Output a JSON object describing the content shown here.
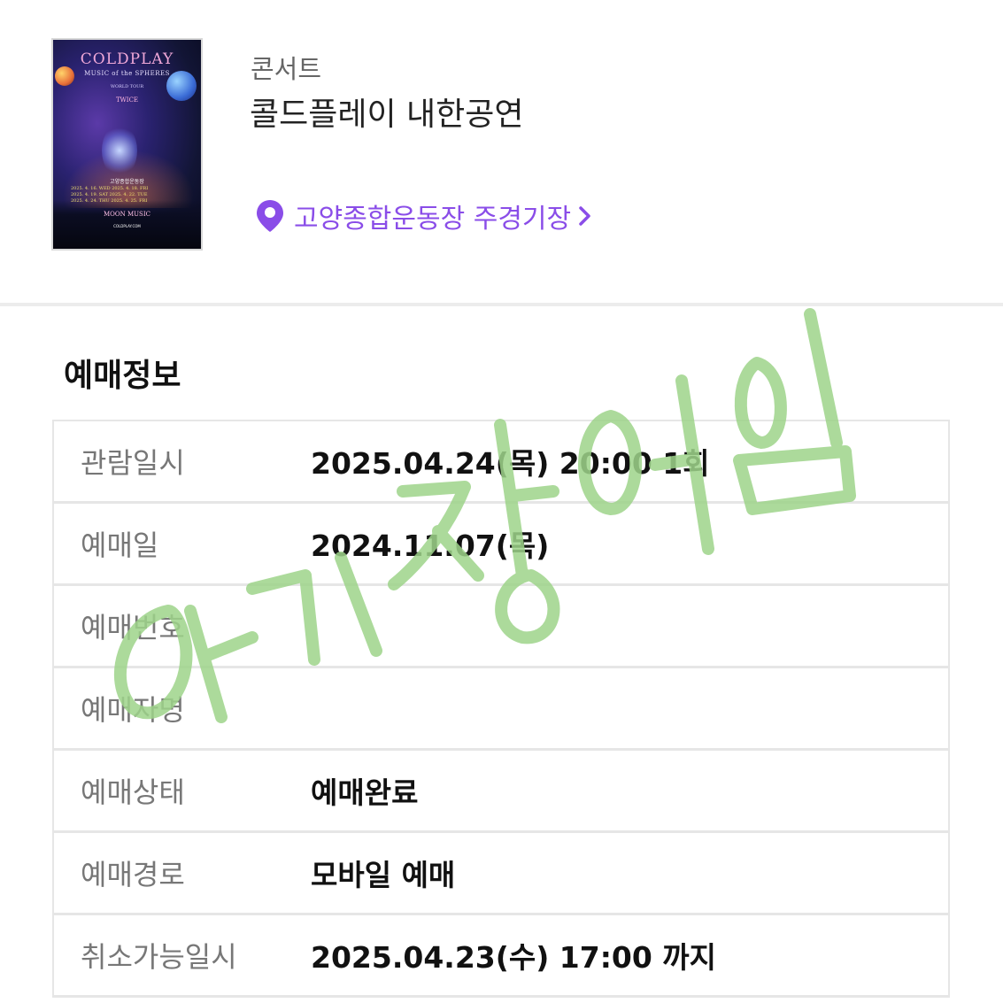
{
  "event": {
    "category": "콘서트",
    "title": "콜드플레이 내한공연",
    "venue": "고양종합운동장 주경기장",
    "poster": {
      "title": "COLDPLAY",
      "subtitle": "MUSIC of the SPHERES",
      "tour": "WORLD TOUR",
      "guest": "TWICE",
      "venue": "고양종합운동장",
      "dates": [
        "2025. 4. 16. WED   2025. 4. 18. FRI",
        "2025. 4. 19. SAT   2025. 4. 22. TUE",
        "2025. 4. 24. THU   2025. 4. 25. FRI"
      ],
      "album": "MOON MUSIC",
      "url": "COLDPLAY.COM"
    }
  },
  "section": {
    "title": "예매정보"
  },
  "info_rows": [
    {
      "label": "관람일시",
      "value": "2025.04.24(목) 20:00 1회"
    },
    {
      "label": "예매일",
      "value": "2024.11.07(목)"
    },
    {
      "label": "예매번호",
      "value": ""
    },
    {
      "label": "예매자명",
      "value": ""
    },
    {
      "label": "예매상태",
      "value": "예매완료"
    },
    {
      "label": "예매경로",
      "value": "모바일 예매"
    },
    {
      "label": "취소가능일시",
      "value": "2025.04.23(수) 17:00 까지"
    }
  ],
  "overlay": {
    "handwriting": "아기장어임",
    "color": "#9ed48a"
  },
  "colors": {
    "accent": "#8a4de8",
    "label": "#777777",
    "divider": "#e6e6e6"
  }
}
